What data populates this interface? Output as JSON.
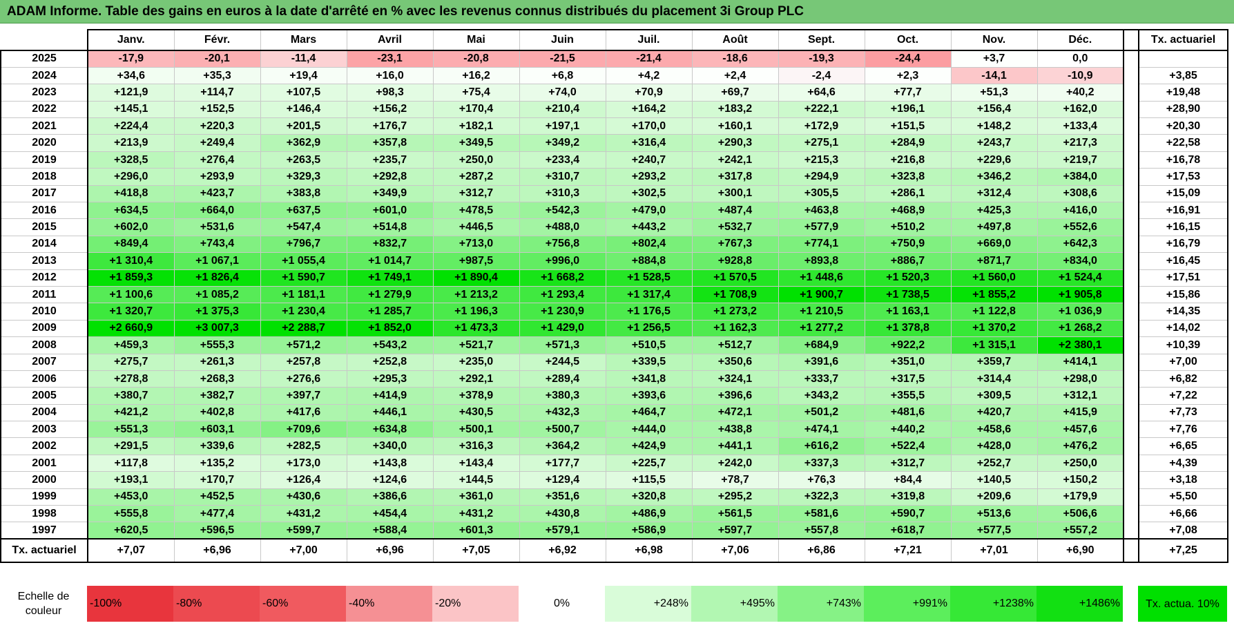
{
  "title": "ADAM Informe. Table des gains en euros à la date d'arrêté en % avec les revenus connus distribués du placement 3i Group PLC",
  "months": [
    "Janv.",
    "Févr.",
    "Mars",
    "Avril",
    "Mai",
    "Juin",
    "Juil.",
    "Août",
    "Sept.",
    "Oct.",
    "Nov.",
    "Déc."
  ],
  "rate_header": "Tx. actuariel",
  "rows": [
    {
      "year": "2025",
      "cells": [
        "-17,9",
        "-20,1",
        "-11,4",
        "-23,1",
        "-20,8",
        "-21,5",
        "-21,4",
        "-18,6",
        "-19,3",
        "-24,4",
        "+3,7",
        "0,0"
      ],
      "rate": ""
    },
    {
      "year": "2024",
      "cells": [
        "+34,6",
        "+35,3",
        "+19,4",
        "+16,0",
        "+16,2",
        "+6,8",
        "+4,2",
        "+2,4",
        "-2,4",
        "+2,3",
        "-14,1",
        "-10,9"
      ],
      "rate": "+3,85"
    },
    {
      "year": "2023",
      "cells": [
        "+121,9",
        "+114,7",
        "+107,5",
        "+98,3",
        "+75,4",
        "+74,0",
        "+70,9",
        "+69,7",
        "+64,6",
        "+77,7",
        "+51,3",
        "+40,2"
      ],
      "rate": "+19,48"
    },
    {
      "year": "2022",
      "cells": [
        "+145,1",
        "+152,5",
        "+146,4",
        "+156,2",
        "+170,4",
        "+210,4",
        "+164,2",
        "+183,2",
        "+222,1",
        "+196,1",
        "+156,4",
        "+162,0"
      ],
      "rate": "+28,90"
    },
    {
      "year": "2021",
      "cells": [
        "+224,4",
        "+220,3",
        "+201,5",
        "+176,7",
        "+182,1",
        "+197,1",
        "+170,0",
        "+160,1",
        "+172,9",
        "+151,5",
        "+148,2",
        "+133,4"
      ],
      "rate": "+20,30"
    },
    {
      "year": "2020",
      "cells": [
        "+213,9",
        "+249,4",
        "+362,9",
        "+357,8",
        "+349,5",
        "+349,2",
        "+316,4",
        "+290,3",
        "+275,1",
        "+284,9",
        "+243,7",
        "+217,3"
      ],
      "rate": "+22,58"
    },
    {
      "year": "2019",
      "cells": [
        "+328,5",
        "+276,4",
        "+263,5",
        "+235,7",
        "+250,0",
        "+233,4",
        "+240,7",
        "+242,1",
        "+215,3",
        "+216,8",
        "+229,6",
        "+219,7"
      ],
      "rate": "+16,78"
    },
    {
      "year": "2018",
      "cells": [
        "+296,0",
        "+293,9",
        "+329,3",
        "+292,8",
        "+287,2",
        "+310,7",
        "+293,2",
        "+317,8",
        "+294,9",
        "+323,8",
        "+346,2",
        "+384,0"
      ],
      "rate": "+17,53"
    },
    {
      "year": "2017",
      "cells": [
        "+418,8",
        "+423,7",
        "+383,8",
        "+349,9",
        "+312,7",
        "+310,3",
        "+302,5",
        "+300,1",
        "+305,5",
        "+286,1",
        "+312,4",
        "+308,6"
      ],
      "rate": "+15,09"
    },
    {
      "year": "2016",
      "cells": [
        "+634,5",
        "+664,0",
        "+637,5",
        "+601,0",
        "+478,5",
        "+542,3",
        "+479,0",
        "+487,4",
        "+463,8",
        "+468,9",
        "+425,3",
        "+416,0"
      ],
      "rate": "+16,91"
    },
    {
      "year": "2015",
      "cells": [
        "+602,0",
        "+531,6",
        "+547,4",
        "+514,8",
        "+446,5",
        "+488,0",
        "+443,2",
        "+532,7",
        "+577,9",
        "+510,2",
        "+497,8",
        "+552,6"
      ],
      "rate": "+16,15"
    },
    {
      "year": "2014",
      "cells": [
        "+849,4",
        "+743,4",
        "+796,7",
        "+832,7",
        "+713,0",
        "+756,8",
        "+802,4",
        "+767,3",
        "+774,1",
        "+750,9",
        "+669,0",
        "+642,3"
      ],
      "rate": "+16,79"
    },
    {
      "year": "2013",
      "cells": [
        "+1 310,4",
        "+1 067,1",
        "+1 055,4",
        "+1 014,7",
        "+987,5",
        "+996,0",
        "+884,8",
        "+928,8",
        "+893,8",
        "+886,7",
        "+871,7",
        "+834,0"
      ],
      "rate": "+16,45"
    },
    {
      "year": "2012",
      "cells": [
        "+1 859,3",
        "+1 826,4",
        "+1 590,7",
        "+1 749,1",
        "+1 890,4",
        "+1 668,2",
        "+1 528,5",
        "+1 570,5",
        "+1 448,6",
        "+1 520,3",
        "+1 560,0",
        "+1 524,4"
      ],
      "rate": "+17,51"
    },
    {
      "year": "2011",
      "cells": [
        "+1 100,6",
        "+1 085,2",
        "+1 181,1",
        "+1 279,9",
        "+1 213,2",
        "+1 293,4",
        "+1 317,4",
        "+1 708,9",
        "+1 900,7",
        "+1 738,5",
        "+1 855,2",
        "+1 905,8"
      ],
      "rate": "+15,86"
    },
    {
      "year": "2010",
      "cells": [
        "+1 320,7",
        "+1 375,3",
        "+1 230,4",
        "+1 285,7",
        "+1 196,3",
        "+1 230,9",
        "+1 176,5",
        "+1 273,2",
        "+1 210,5",
        "+1 163,1",
        "+1 122,8",
        "+1 036,9"
      ],
      "rate": "+14,35"
    },
    {
      "year": "2009",
      "cells": [
        "+2 660,9",
        "+3 007,3",
        "+2 288,7",
        "+1 852,0",
        "+1 473,3",
        "+1 429,0",
        "+1 256,5",
        "+1 162,3",
        "+1 277,2",
        "+1 378,8",
        "+1 370,2",
        "+1 268,2"
      ],
      "rate": "+14,02"
    },
    {
      "year": "2008",
      "cells": [
        "+459,3",
        "+555,3",
        "+571,2",
        "+543,2",
        "+521,7",
        "+571,3",
        "+510,5",
        "+512,7",
        "+684,9",
        "+922,2",
        "+1 315,1",
        "+2 380,1"
      ],
      "rate": "+10,39"
    },
    {
      "year": "2007",
      "cells": [
        "+275,7",
        "+261,3",
        "+257,8",
        "+252,8",
        "+235,0",
        "+244,5",
        "+339,5",
        "+350,6",
        "+391,6",
        "+351,0",
        "+359,7",
        "+414,1"
      ],
      "rate": "+7,00"
    },
    {
      "year": "2006",
      "cells": [
        "+278,8",
        "+268,3",
        "+276,6",
        "+295,3",
        "+292,1",
        "+289,4",
        "+341,8",
        "+324,1",
        "+333,7",
        "+317,5",
        "+314,4",
        "+298,0"
      ],
      "rate": "+6,82"
    },
    {
      "year": "2005",
      "cells": [
        "+380,7",
        "+382,7",
        "+397,7",
        "+414,9",
        "+378,9",
        "+380,3",
        "+393,6",
        "+396,6",
        "+343,2",
        "+355,5",
        "+309,5",
        "+312,1"
      ],
      "rate": "+7,22"
    },
    {
      "year": "2004",
      "cells": [
        "+421,2",
        "+402,8",
        "+417,6",
        "+446,1",
        "+430,5",
        "+432,3",
        "+464,7",
        "+472,1",
        "+501,2",
        "+481,6",
        "+420,7",
        "+415,9"
      ],
      "rate": "+7,73"
    },
    {
      "year": "2003",
      "cells": [
        "+551,3",
        "+603,1",
        "+709,6",
        "+634,8",
        "+500,1",
        "+500,7",
        "+444,0",
        "+438,8",
        "+474,1",
        "+440,2",
        "+458,6",
        "+457,6"
      ],
      "rate": "+7,76"
    },
    {
      "year": "2002",
      "cells": [
        "+291,5",
        "+339,6",
        "+282,5",
        "+340,0",
        "+316,3",
        "+364,2",
        "+424,9",
        "+441,1",
        "+616,2",
        "+522,4",
        "+428,0",
        "+476,2"
      ],
      "rate": "+6,65"
    },
    {
      "year": "2001",
      "cells": [
        "+117,8",
        "+135,2",
        "+173,0",
        "+143,8",
        "+143,4",
        "+177,7",
        "+225,7",
        "+242,0",
        "+337,3",
        "+312,7",
        "+252,7",
        "+250,0"
      ],
      "rate": "+4,39"
    },
    {
      "year": "2000",
      "cells": [
        "+193,1",
        "+170,7",
        "+126,4",
        "+124,6",
        "+144,5",
        "+129,4",
        "+115,5",
        "+78,7",
        "+76,3",
        "+84,4",
        "+140,5",
        "+150,2"
      ],
      "rate": "+3,18"
    },
    {
      "year": "1999",
      "cells": [
        "+453,0",
        "+452,5",
        "+430,6",
        "+386,6",
        "+361,0",
        "+351,6",
        "+320,8",
        "+295,2",
        "+322,3",
        "+319,8",
        "+209,6",
        "+179,9"
      ],
      "rate": "+5,50"
    },
    {
      "year": "1998",
      "cells": [
        "+555,8",
        "+477,4",
        "+431,2",
        "+454,4",
        "+431,2",
        "+430,8",
        "+486,9",
        "+561,5",
        "+581,6",
        "+590,7",
        "+513,6",
        "+506,6"
      ],
      "rate": "+6,66"
    },
    {
      "year": "1997",
      "cells": [
        "+620,5",
        "+596,5",
        "+599,7",
        "+588,4",
        "+601,3",
        "+579,1",
        "+586,9",
        "+597,7",
        "+557,8",
        "+618,7",
        "+577,5",
        "+557,2"
      ],
      "rate": "+7,08"
    }
  ],
  "footer": {
    "label": "Tx. actuariel",
    "cells": [
      "+7,07",
      "+6,96",
      "+7,00",
      "+6,96",
      "+7,05",
      "+6,92",
      "+6,98",
      "+7,06",
      "+6,86",
      "+7,21",
      "+7,01",
      "+6,90"
    ],
    "rate": "+7,25"
  },
  "scale": {
    "label": "Echelle de couleur",
    "steps": [
      {
        "text": "-100%",
        "color": "#e8353d",
        "align": "neg"
      },
      {
        "text": "-80%",
        "color": "#ec4a50",
        "align": "neg"
      },
      {
        "text": "-60%",
        "color": "#f05a5f",
        "align": "neg"
      },
      {
        "text": "-40%",
        "color": "#f59094",
        "align": "neg"
      },
      {
        "text": "-20%",
        "color": "#fbc4c6",
        "align": "neg"
      },
      {
        "text": "0%",
        "color": "#ffffff",
        "align": "zero"
      },
      {
        "text": "+248%",
        "color": "#d9fcd9",
        "align": "pos"
      },
      {
        "text": "+495%",
        "color": "#b2f7b2",
        "align": "pos"
      },
      {
        "text": "+743%",
        "color": "#86f286",
        "align": "pos"
      },
      {
        "text": "+991%",
        "color": "#5cee5c",
        "align": "pos"
      },
      {
        "text": "+1238%",
        "color": "#36e836",
        "align": "pos"
      },
      {
        "text": "+1486%",
        "color": "#12e012",
        "align": "pos"
      }
    ],
    "ref_label": "Tx. actua. 10%",
    "ref_color": "#00e000"
  }
}
